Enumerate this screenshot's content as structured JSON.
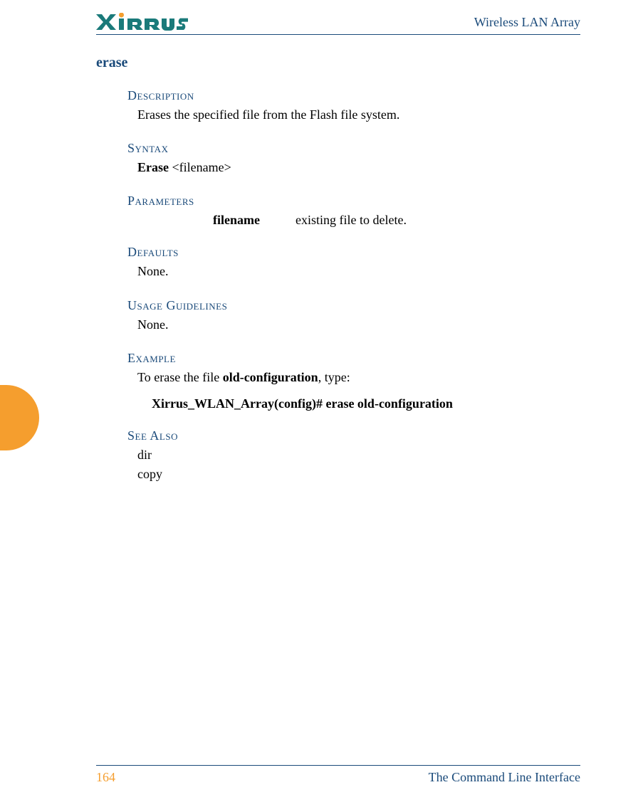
{
  "header": {
    "doc_title": "Wireless LAN Array"
  },
  "command": {
    "title": "erase"
  },
  "description": {
    "heading": "Description",
    "body": "Erases the specified file from the Flash file system."
  },
  "syntax": {
    "heading": "Syntax",
    "cmd_bold": "Erase",
    "cmd_arg": "  <filename>"
  },
  "parameters": {
    "heading": "Parameters",
    "name": "filename",
    "desc": "existing file to delete."
  },
  "defaults": {
    "heading": "Defaults",
    "body": "None."
  },
  "usage": {
    "heading": "Usage Guidelines",
    "body": "None."
  },
  "example": {
    "heading": "Example",
    "intro_pre": "To erase the file ",
    "intro_bold": "old-configuration",
    "intro_post": ", type:",
    "cmd": "Xirrus_WLAN_Array(config)# erase old-configuration"
  },
  "see_also": {
    "heading": "See Also",
    "item1": "dir",
    "item2": "copy"
  },
  "footer": {
    "page": "164",
    "section": "The Command Line Interface"
  }
}
